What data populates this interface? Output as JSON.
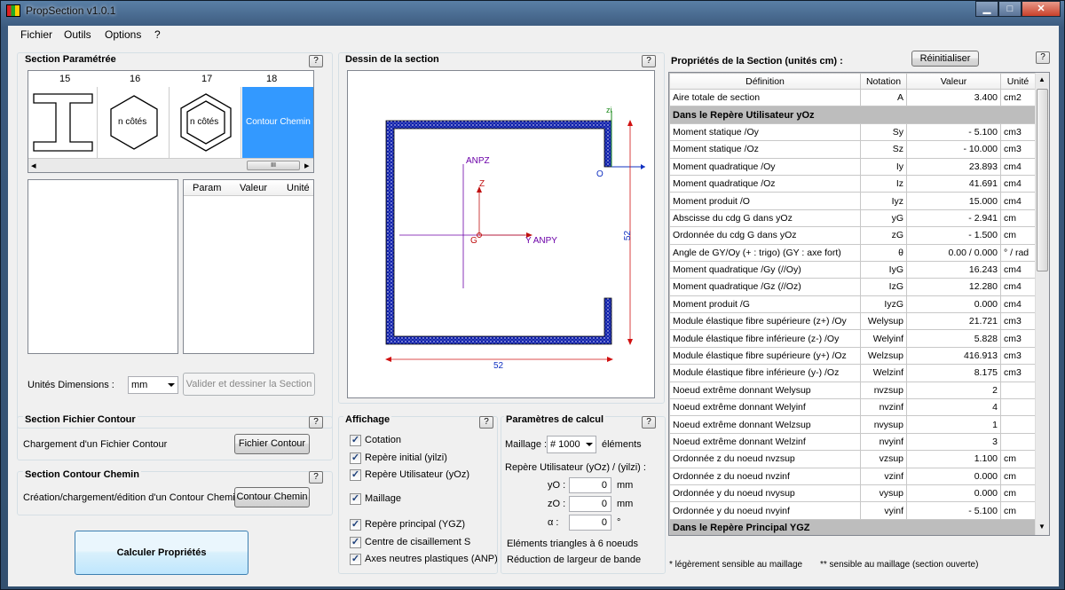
{
  "window": {
    "title": "PropSection v1.0.1",
    "min": "▁",
    "max": "□",
    "close": "✕"
  },
  "menu": [
    "Fichier",
    "Outils",
    "Options",
    "?"
  ],
  "section_param": {
    "title": "Section Paramétrée",
    "help": "?",
    "cols": [
      "15",
      "16",
      "17",
      "18"
    ],
    "shape16": "n côtés",
    "shape17": "n côtés",
    "shape18": "Contour Chemin",
    "scroll_thumb": "III",
    "left_arrow": "◂",
    "right_arrow": "▸",
    "param_headers": [
      "Param",
      "Valeur",
      "Unité"
    ],
    "units_label": "Unités Dimensions :",
    "units_value": "mm",
    "validate_btn": "Valider et dessiner la Section"
  },
  "fichier_contour": {
    "title": "Section Fichier Contour",
    "help": "?",
    "label": "Chargement d'un Fichier Contour",
    "btn": "Fichier Contour"
  },
  "contour_chemin": {
    "title": "Section Contour Chemin",
    "help": "?",
    "label": "Création/chargement/édition d'un Contour Chemin",
    "btn": "Contour Chemin"
  },
  "calc_btn": "Calculer Propriétés",
  "dessin": {
    "title": "Dessin de la section",
    "help": "?",
    "anpz": "ANPZ",
    "z": "Z",
    "g": "G",
    "yanpy": "Y ANPY",
    "zi": "zi",
    "o": "O",
    "dim_h": "52",
    "dim_v": "52"
  },
  "affichage": {
    "title": "Affichage",
    "help": "?",
    "items": [
      {
        "label": "Cotation",
        "checked": "✓"
      },
      {
        "label": "Repère initial (yilzi)",
        "checked": "✓"
      },
      {
        "label": "Repère Utilisateur (yOz)",
        "checked": "✓"
      },
      {
        "label": "Maillage",
        "checked": "✓"
      },
      {
        "label": "Repère principal (YGZ)",
        "checked": "✓"
      },
      {
        "label": "Centre de cisaillement S",
        "checked": "✓"
      },
      {
        "label": "Axes neutres plastiques (ANP)",
        "checked": "✓"
      }
    ]
  },
  "params": {
    "title": "Paramètres de calcul",
    "help": "?",
    "maillage_label": "Maillage :",
    "maillage_value": "# 1000",
    "elements": "éléments",
    "repere_label": "Repère Utilisateur (yOz)  /  (yilzi)  :",
    "yo_label": "yO :",
    "yo_value": "0",
    "yo_unit": "mm",
    "zo_label": "zO :",
    "zo_value": "0",
    "zo_unit": "mm",
    "alpha_label": "α  :",
    "alpha_value": "0",
    "alpha_unit": "°",
    "note1": "Eléments triangles à 6 noeuds",
    "note2": "Réduction de largeur de bande"
  },
  "props": {
    "title": "Propriétés de la Section (unités cm) :",
    "reset_btn": "Réinitialiser",
    "help": "?",
    "headers": [
      "Définition",
      "Notation",
      "Valeur",
      "Unité"
    ],
    "rows": [
      {
        "d": "Aire totale de section",
        "n": "A",
        "v": "3.400",
        "u": "cm2"
      },
      {
        "sec": "Dans le Repère Utilisateur yOz"
      },
      {
        "d": "Moment statique /Oy",
        "n": "Sy",
        "v": "-  5.100",
        "u": "cm3"
      },
      {
        "d": "Moment statique /Oz",
        "n": "Sz",
        "v": "-  10.000",
        "u": "cm3"
      },
      {
        "d": "Moment quadratique /Oy",
        "n": "Iy",
        "v": "23.893",
        "u": "cm4"
      },
      {
        "d": "Moment quadratique /Oz",
        "n": "Iz",
        "v": "41.691",
        "u": "cm4"
      },
      {
        "d": "Moment produit /O",
        "n": "Iyz",
        "v": "15.000",
        "u": "cm4"
      },
      {
        "d": "Abscisse du cdg G dans yOz",
        "n": "yG",
        "v": "-  2.941",
        "u": "cm"
      },
      {
        "d": "Ordonnée du cdg G dans yOz",
        "n": "zG",
        "v": "-  1.500",
        "u": "cm"
      },
      {
        "d": "Angle de GY/Oy    (+ : trigo)  (GY : axe fort)",
        "n": "θ",
        "v": "0.00  /  0.000",
        "u": "° / rad"
      },
      {
        "d": "Moment quadratique /Gy (//Oy)",
        "n": "IyG",
        "v": "16.243",
        "u": "cm4"
      },
      {
        "d": "Moment quadratique /Gz (//Oz)",
        "n": "IzG",
        "v": "12.280",
        "u": "cm4"
      },
      {
        "d": "Moment produit /G",
        "n": "IyzG",
        "v": "0.000",
        "u": "cm4"
      },
      {
        "d": "Module élastique fibre supérieure (z+) /Oy",
        "n": "Welysup",
        "v": "21.721",
        "u": "cm3"
      },
      {
        "d": "Module élastique fibre inférieure (z-) /Oy",
        "n": "Welyinf",
        "v": "5.828",
        "u": "cm3"
      },
      {
        "d": "Module élastique fibre supérieure (y+) /Oz",
        "n": "Welzsup",
        "v": "416.913",
        "u": "cm3"
      },
      {
        "d": "Module élastique fibre inférieure (y-) /Oz",
        "n": "Welzinf",
        "v": "8.175",
        "u": "cm3"
      },
      {
        "d": "Noeud extrême donnant Welysup",
        "n": "nvzsup",
        "v": "2",
        "u": ""
      },
      {
        "d": "Noeud extrême donnant Welyinf",
        "n": "nvzinf",
        "v": "4",
        "u": ""
      },
      {
        "d": "Noeud extrême donnant Welzsup",
        "n": "nvysup",
        "v": "1",
        "u": ""
      },
      {
        "d": "Noeud extrême donnant Welzinf",
        "n": "nvyinf",
        "v": "3",
        "u": ""
      },
      {
        "d": "Ordonnée z du noeud nvzsup",
        "n": "vzsup",
        "v": "1.100",
        "u": "cm"
      },
      {
        "d": "Ordonnée z du noeud nvzinf",
        "n": "vzinf",
        "v": "0.000",
        "u": "cm"
      },
      {
        "d": "Ordonnée y du noeud nvysup",
        "n": "vysup",
        "v": "0.000",
        "u": "cm"
      },
      {
        "d": "Ordonnée y du noeud nvyinf",
        "n": "vyinf",
        "v": "-  5.100",
        "u": "cm"
      },
      {
        "sec": "Dans le Repère Principal YGZ"
      }
    ],
    "foot1": "* légèrement sensible au maillage",
    "foot2": "** sensible au maillage (section ouverte)"
  }
}
